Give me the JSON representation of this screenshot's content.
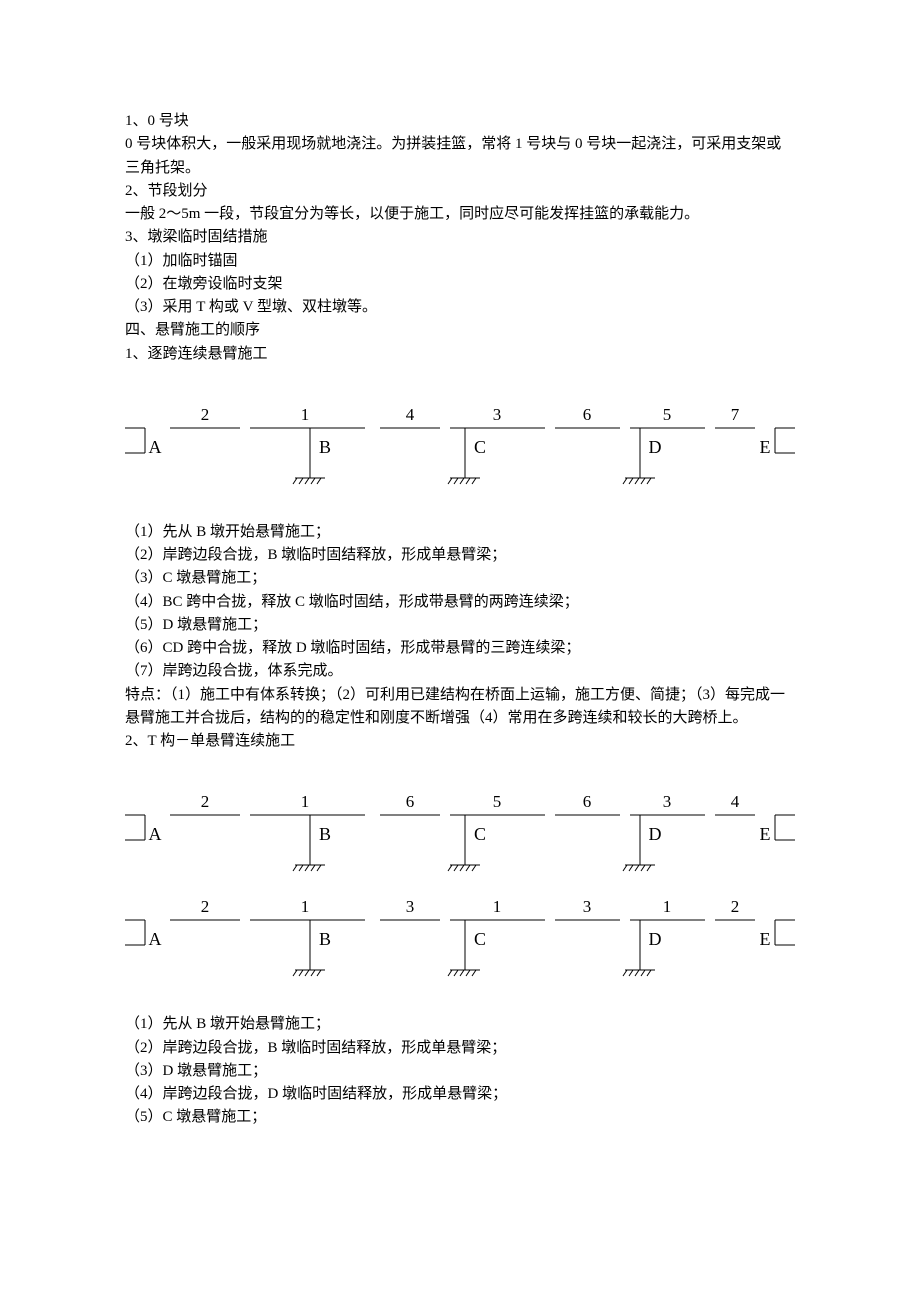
{
  "s1": {
    "h": "1、0 号块",
    "p1": "0 号块体积大，一般采用现场就地浇注。为拼装挂篮，常将 1 号块与 0 号块一起浇注，可采用支架或三角托架。"
  },
  "s2": {
    "h": "2、节段划分",
    "p1": "一般 2～5m 一段，节段宜分为等长，以便于施工，同时应尽可能发挥挂篮的承载能力。"
  },
  "s3": {
    "h": "3、墩梁临时固结措施",
    "i1": "（1）加临时锚固",
    "i2": "（2）在墩旁设临时支架",
    "i3": "（3）采用 T 构或 V 型墩、双柱墩等。"
  },
  "s4": {
    "h": "四、悬臂施工的顺序",
    "sub1": "1、逐跨连续悬臂施工"
  },
  "diag1": {
    "labels": [
      "A",
      "B",
      "C",
      "D",
      "E"
    ],
    "top": [
      "2",
      "1",
      "4",
      "3",
      "6",
      "5",
      "7"
    ]
  },
  "after1": {
    "i1": "（1）先从 B 墩开始悬臂施工；",
    "i2": "（2）岸跨边段合拢，B 墩临时固结释放，形成单悬臂梁；",
    "i3": "（3）C 墩悬臂施工；",
    "i4": "（4）BC 跨中合拢，释放 C 墩临时固结，形成带悬臂的两跨连续梁；",
    "i5": "（5）D 墩悬臂施工；",
    "i6": "（6）CD 跨中合拢，释放 D 墩临时固结，形成带悬臂的三跨连续梁；",
    "i7": "（7）岸跨边段合拢，体系完成。",
    "feat": "特点：（1）施工中有体系转换；（2）可利用已建结构在桥面上运输，施工方便、简捷；（3）每完成一悬臂施工并合拢后，结构的的稳定性和刚度不断增强（4）常用在多跨连续和较长的大跨桥上。",
    "sub2": "2、T 构－单悬臂连续施工"
  },
  "diag2a": {
    "labels": [
      "A",
      "B",
      "C",
      "D",
      "E"
    ],
    "top": [
      "2",
      "1",
      "6",
      "5",
      "6",
      "3",
      "4"
    ]
  },
  "diag2b": {
    "labels": [
      "A",
      "B",
      "C",
      "D",
      "E"
    ],
    "top": [
      "2",
      "1",
      "3",
      "1",
      "3",
      "1",
      "2"
    ]
  },
  "after2": {
    "i1": "（1）先从 B 墩开始悬臂施工；",
    "i2": "（2）岸跨边段合拢，B 墩临时固结释放，形成单悬臂梁；",
    "i3": "（3）D 墩悬臂施工；",
    "i4": "（4）岸跨边段合拢，D 墩临时固结释放，形成单悬臂梁；",
    "i5": "（5）C 墩悬臂施工；"
  }
}
